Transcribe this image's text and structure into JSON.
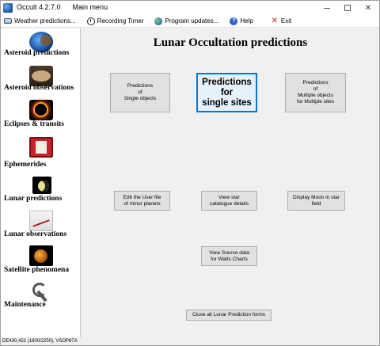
{
  "window": {
    "title": "Occult 4.2.7.0",
    "menu_title": "Main menu",
    "controls": {
      "minimize": "–",
      "maximize": "",
      "close": "✕"
    }
  },
  "menubar": [
    {
      "label": "Weather predictions...",
      "icon": "weather-icon"
    },
    {
      "label": "Recording Timer",
      "icon": "clock-icon"
    },
    {
      "label": "Program updates...",
      "icon": "globe-icon"
    },
    {
      "label": "Help",
      "icon": "help-icon",
      "glyph": "?"
    },
    {
      "label": "Exit",
      "icon": "exit-icon",
      "glyph": "✕"
    }
  ],
  "sidebar": {
    "items": [
      {
        "label": "Asteroid predictions",
        "icon": "asteroid-predictions-icon"
      },
      {
        "label": "Asteroid observations",
        "icon": "asteroid-observations-icon"
      },
      {
        "label": "Eclipses & transits",
        "icon": "eclipses-icon"
      },
      {
        "label": "Ephemerides",
        "icon": "ephemerides-icon"
      },
      {
        "label": "Lunar predictions",
        "icon": "lunar-predictions-icon"
      },
      {
        "label": "Lunar observations",
        "icon": "lunar-observations-icon"
      },
      {
        "label": "Satellite phenomena",
        "icon": "satellite-icon"
      },
      {
        "label": "Maintenance",
        "icon": "maintenance-icon"
      }
    ]
  },
  "status_text": "DE430,422 (1600/2250), VSOP87A",
  "main": {
    "title": "Lunar Occultation predictions",
    "buttons": {
      "single_objects": "Predictions\nof\nSingle objects",
      "single_sites": "Predictions\nfor\nsingle sites",
      "multiple_objects": "Predictions\nof\nMultiple objects\nfor Multiple sites",
      "edit_user_file": "Edit the User file\nof minor planets",
      "view_star_catalogue": "View star\ncatalogue details",
      "display_moon": "Display Moon in star\nfield",
      "view_source_data": "View Source data\nfor Watts Charts",
      "close_all": "Close all Lunar Prediction forms"
    }
  },
  "colors": {
    "accent": "#0078d7",
    "button_bg": "#e1e1e1",
    "panel_bg": "#f0f0f0"
  }
}
